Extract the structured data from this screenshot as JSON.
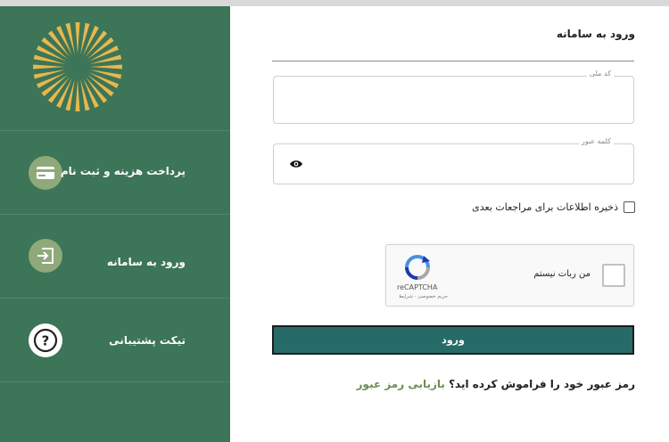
{
  "colors": {
    "sidebar": "#3c7557",
    "accent": "#266b67",
    "logo": "#e7b74f",
    "link": "#6f8b56"
  },
  "sidebar": {
    "items": [
      {
        "label": "پرداخت هزینه و ثبت نام",
        "icon": "card-icon"
      },
      {
        "label": "ورود به سامانه",
        "icon": "login-icon"
      },
      {
        "label": "تیکت پشتیبانی",
        "icon": "question-icon"
      }
    ]
  },
  "form": {
    "title": "ورود به سامانه",
    "national_code": {
      "label": "کد ملی",
      "value": ""
    },
    "password": {
      "label": "کلمه عبور",
      "value": ""
    },
    "remember_label": "ذخیره اطلاعات برای مراجعات بعدی",
    "captcha": {
      "text": "من ربات نیستم",
      "brand": "reCAPTCHA",
      "links": "حریم خصوصی - شرایط"
    },
    "submit_label": "ورود",
    "forgot_text": "رمز عبور خود را فراموش کرده اید؟",
    "forgot_link": "بازیابی رمز عبور"
  }
}
